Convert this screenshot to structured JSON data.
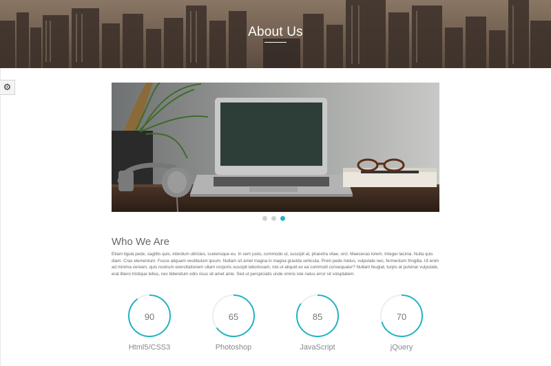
{
  "header": {
    "title": "About Us"
  },
  "settings": {
    "icon": "gear-icon"
  },
  "slider": {
    "slide_count": 3,
    "active_index": 2
  },
  "about": {
    "title": "Who We Are",
    "body": "Etiam ligula pede, sagittis quis, interdum ultricies, scelerisque eu. In sem justo, commodo ut, suscipit at, pharetra vitae, orci. Maecenas lorem. Integer lacinia. Nulla quis diam. Cras elementum. Fusce aliquam vestibulum ipsum. Nullam sit amet magna in magna gravida vehicula. Proin pede metus, vulputate nec, fermentum fringilla. Ut enim ad minima veniam, quis nostrum exercitationem ullam corporis suscipit laboriosam, nisi ut aliquid ex ea commodi consequatur? Nullam feugiat, turpis at pulvinar vulputate, erat libero tristique tellus, nec bibendum odio risus sit amet ante. Sed ut perspiciatis unde omnis iste natus error sit voluptatem."
  },
  "skills": [
    {
      "label": "Html5/CSS3",
      "value": "90"
    },
    {
      "label": "Photoshop",
      "value": "65"
    },
    {
      "label": "JavaScript",
      "value": "85"
    },
    {
      "label": "jQuery",
      "value": "70"
    }
  ],
  "colors": {
    "accent": "#1fb3c4",
    "ring_track": "#eeeeee"
  }
}
